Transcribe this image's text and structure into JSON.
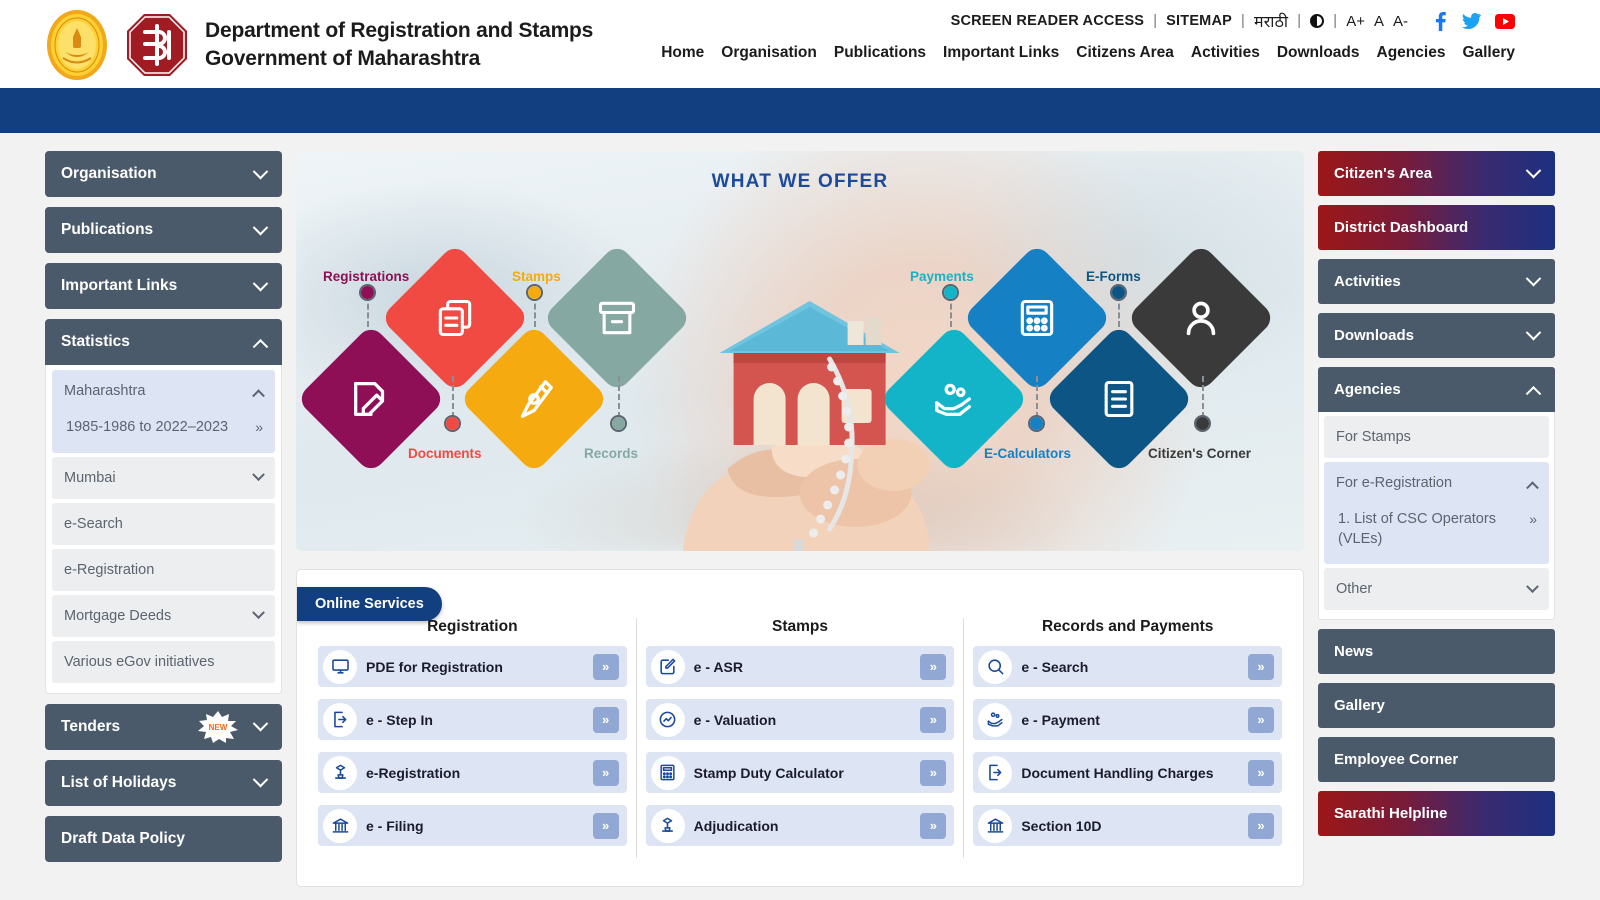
{
  "header": {
    "org_line1": "Department of Registration and Stamps",
    "org_line2": "Government of Maharashtra",
    "emblem_gold_name": "maharashtra-state-emblem",
    "emblem_red_name": "igr-department-logo",
    "utility": {
      "screen_reader": "SCREEN READER ACCESS",
      "sitemap": "SITEMAP",
      "marathi": "मराठी",
      "sep": "|",
      "font_larger": "A+",
      "font_normal": "A",
      "font_smaller": "A-"
    },
    "social": [
      "facebook-icon",
      "twitter-icon",
      "youtube-icon"
    ],
    "nav": [
      "Home",
      "Organisation",
      "Publications",
      "Important Links",
      "Citizens Area",
      "Activities",
      "Downloads",
      "Agencies",
      "Gallery"
    ]
  },
  "left_sidebar": {
    "organisation": "Organisation",
    "publications": "Publications",
    "important_links": "Important Links",
    "statistics": "Statistics",
    "statistics_sub": {
      "maharashtra": "Maharashtra",
      "maharashtra_range": "1985-1986 to 2022–2023",
      "mumbai": "Mumbai",
      "e_search": "e-Search",
      "e_registration": "e-Registration",
      "mortgage_deeds": "Mortgage Deeds",
      "various_egov": "Various eGov initiatives"
    },
    "tenders": "Tenders",
    "tenders_badge": "NEW",
    "list_of_holidays": "List of Holidays",
    "draft_data_policy": "Draft Data Policy"
  },
  "hero": {
    "title": "WHAT WE OFFER",
    "nodes": [
      {
        "label": "Registrations",
        "color": "#8e0f56",
        "icon": "document-edit-icon"
      },
      {
        "label": "Documents",
        "color": "#f04a43",
        "icon": "copy-documents-icon"
      },
      {
        "label": "Stamps",
        "color": "#f5ab10",
        "icon": "pen-nib-icon"
      },
      {
        "label": "Records",
        "color": "#86a8a2",
        "icon": "archive-box-icon"
      },
      {
        "label": "Payments",
        "color": "#14b4c8",
        "icon": "hand-coins-icon"
      },
      {
        "label": "E-Calculators",
        "color": "#1680c4",
        "icon": "calculator-icon"
      },
      {
        "label": "E-Forms",
        "color": "#0c5584",
        "icon": "form-list-icon"
      },
      {
        "label": "Citizen's Corner",
        "color": "#3a3a3a",
        "icon": "user-person-icon"
      }
    ]
  },
  "online_services": {
    "tab_label": "Online Services",
    "columns": [
      {
        "title": "Registration",
        "items": [
          {
            "label": "PDE for Registration",
            "icon": "monitor-icon",
            "go": "»"
          },
          {
            "label": "e - Step In",
            "icon": "step-in-icon",
            "go": "»"
          },
          {
            "label": "e-Registration",
            "icon": "stamp-icon",
            "go": "»"
          },
          {
            "label": "e - Filing",
            "icon": "bank-icon",
            "go": "»"
          }
        ]
      },
      {
        "title": "Stamps",
        "items": [
          {
            "label": "e - ASR",
            "icon": "edit-note-icon",
            "go": "»"
          },
          {
            "label": "e - Valuation",
            "icon": "chart-circle-icon",
            "go": "»"
          },
          {
            "label": "Stamp Duty Calculator",
            "icon": "calculator-icon",
            "go": "»"
          },
          {
            "label": "Adjudication",
            "icon": "stamp-icon",
            "go": "»"
          }
        ]
      },
      {
        "title": "Records and Payments",
        "items": [
          {
            "label": "e - Search",
            "icon": "search-icon",
            "go": "»"
          },
          {
            "label": "e - Payment",
            "icon": "hand-coins-icon",
            "go": "»"
          },
          {
            "label": "Document Handling Charges",
            "icon": "step-in-icon",
            "go": "»"
          },
          {
            "label": "Section 10D",
            "icon": "bank-icon",
            "go": "»"
          }
        ]
      }
    ]
  },
  "right_sidebar": {
    "citizens_area": "Citizen's Area",
    "district_dashboard": "District Dashboard",
    "activities": "Activities",
    "downloads": "Downloads",
    "agencies": "Agencies",
    "agencies_sub": {
      "for_stamps": "For Stamps",
      "for_eregistration": "For e-Registration",
      "csc_operators": "1. List of CSC Operators (VLEs)",
      "other": "Other"
    },
    "news": "News",
    "gallery": "Gallery",
    "employee_corner": "Employee Corner",
    "sarathi_helpline": "Sarathi Helpline"
  },
  "colors": {
    "band_blue": "#123f7f",
    "sidebar_slate": "#4b5a6b",
    "accent_light_blue": "#dde5f5",
    "gradient_red": "#9c1717",
    "gradient_navy": "#1c3080"
  }
}
